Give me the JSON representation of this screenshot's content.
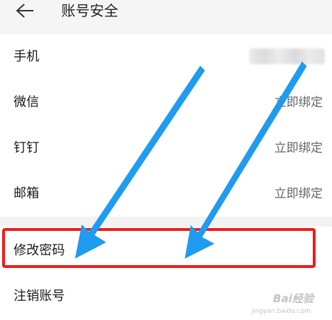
{
  "header": {
    "title": "账号安全",
    "back_icon": "arrow-left-icon"
  },
  "rows": [
    {
      "label": "手机",
      "value": ""
    },
    {
      "label": "微信",
      "value": "立即绑定"
    },
    {
      "label": "钉钉",
      "value": "立即绑定"
    },
    {
      "label": "邮箱",
      "value": "立即绑定"
    },
    {
      "label": "修改密码",
      "value": ""
    },
    {
      "label": "注销账号",
      "value": ""
    }
  ],
  "annotations": {
    "highlight_color": "#ee1c1c",
    "arrow_color": "#1f9bf0"
  },
  "watermark": {
    "brand": "Bai经验",
    "url": "jingyan.baidu.com"
  }
}
